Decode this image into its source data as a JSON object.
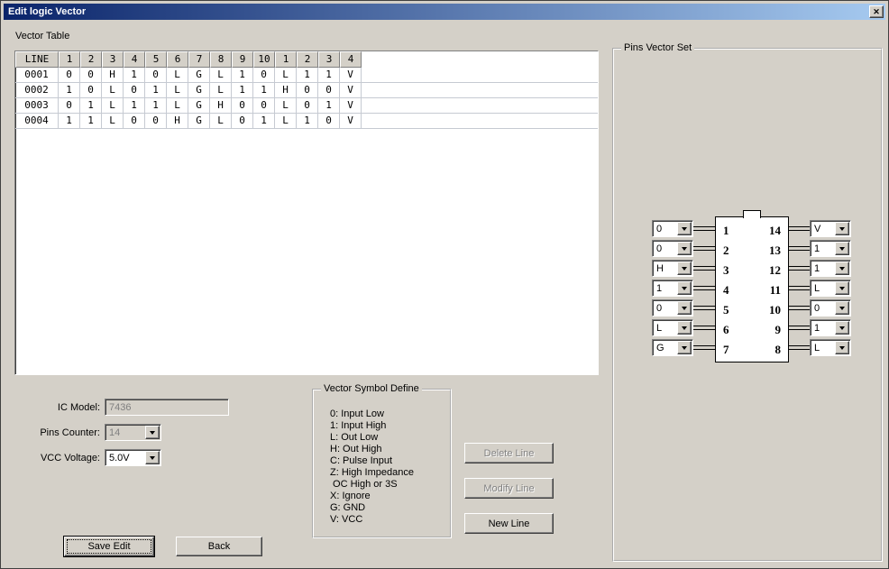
{
  "window": {
    "title": "Edit logic Vector",
    "close_glyph": "✕"
  },
  "colors": {
    "titlebar_start": "#0a246a",
    "titlebar_end": "#a6caf0",
    "dialog_bg": "#d4d0c8",
    "disabled_text": "#808080",
    "table_grid": "#c6cad2"
  },
  "vector_table": {
    "label": "Vector Table",
    "headers": [
      "LINE",
      "1",
      "2",
      "3",
      "4",
      "5",
      "6",
      "7",
      "8",
      "9",
      "10",
      "1",
      "2",
      "3",
      "4"
    ],
    "rows": [
      {
        "line": "0001",
        "values": [
          "0",
          "0",
          "H",
          "1",
          "0",
          "L",
          "G",
          "L",
          "1",
          "0",
          "L",
          "1",
          "1",
          "V"
        ]
      },
      {
        "line": "0002",
        "values": [
          "1",
          "0",
          "L",
          "0",
          "1",
          "L",
          "G",
          "L",
          "1",
          "1",
          "H",
          "0",
          "0",
          "V"
        ]
      },
      {
        "line": "0003",
        "values": [
          "0",
          "1",
          "L",
          "1",
          "1",
          "L",
          "G",
          "H",
          "0",
          "0",
          "L",
          "0",
          "1",
          "V"
        ]
      },
      {
        "line": "0004",
        "values": [
          "1",
          "1",
          "L",
          "0",
          "0",
          "H",
          "G",
          "L",
          "0",
          "1",
          "L",
          "1",
          "0",
          "V"
        ]
      }
    ]
  },
  "form": {
    "ic_model_label": "IC Model:",
    "ic_model_value": "7436",
    "pins_counter_label": "Pins Counter:",
    "pins_counter_value": "14",
    "vcc_voltage_label": "VCC Voltage:",
    "vcc_voltage_value": "5.0V"
  },
  "symbol_define": {
    "label": "Vector Symbol Define",
    "lines": [
      "0: Input Low",
      "1: Input High",
      "L: Out Low",
      "H: Out High",
      "C: Pulse Input",
      "Z: High Impedance",
      " OC High or 3S",
      "X: Ignore",
      "G: GND",
      "V: VCC"
    ]
  },
  "buttons": {
    "delete_line": "Delete Line",
    "modify_line": "Modify Line",
    "new_line": "New Line",
    "save_edit": "Save Edit",
    "back": "Back"
  },
  "pins_vector_set": {
    "label": "Pins Vector Set",
    "left_pins": [
      {
        "pin": "1",
        "value": "0"
      },
      {
        "pin": "2",
        "value": "0"
      },
      {
        "pin": "3",
        "value": "H"
      },
      {
        "pin": "4",
        "value": "1"
      },
      {
        "pin": "5",
        "value": "0"
      },
      {
        "pin": "6",
        "value": "L"
      },
      {
        "pin": "7",
        "value": "G"
      }
    ],
    "right_pins": [
      {
        "pin": "14",
        "value": "V"
      },
      {
        "pin": "13",
        "value": "1"
      },
      {
        "pin": "12",
        "value": "1"
      },
      {
        "pin": "11",
        "value": "L"
      },
      {
        "pin": "10",
        "value": "0"
      },
      {
        "pin": "9",
        "value": "1"
      },
      {
        "pin": "8",
        "value": "L"
      }
    ]
  }
}
